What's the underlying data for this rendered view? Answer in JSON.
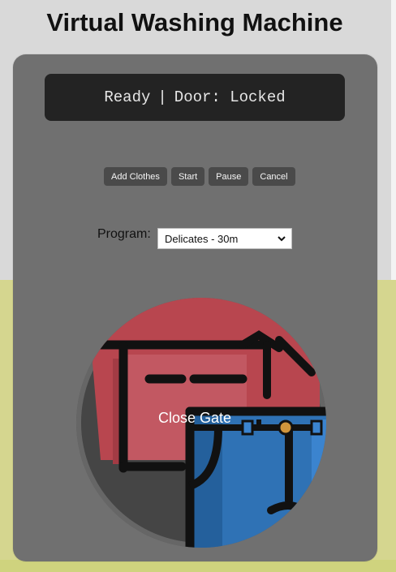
{
  "page": {
    "title": "Virtual Washing Machine"
  },
  "display": {
    "status": "Ready",
    "separator": "|",
    "door": "Door: Locked"
  },
  "controls": {
    "add_clothes": "Add Clothes",
    "start": "Start",
    "pause": "Pause",
    "cancel": "Cancel"
  },
  "program": {
    "label": "Program:",
    "selected": "Delicates - 30m"
  },
  "drum": {
    "gate_label": "Close Gate"
  },
  "colors": {
    "machine_body": "#707070",
    "display_bg": "#232323",
    "button_bg": "#4a4a4a",
    "shirt_red": "#b8464f",
    "jeans_blue": "#2f72b5"
  }
}
